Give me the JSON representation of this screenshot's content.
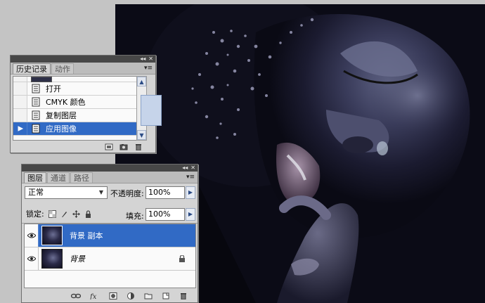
{
  "history_panel": {
    "tabs": [
      {
        "label": "历史记录",
        "active": true
      },
      {
        "label": "动作",
        "active": false
      }
    ],
    "items": [
      {
        "label": "",
        "partial": true,
        "selected": false
      },
      {
        "label": "打开",
        "selected": false
      },
      {
        "label": "CMYK 颜色",
        "selected": false
      },
      {
        "label": "复制图层",
        "selected": false
      },
      {
        "label": "应用图像",
        "selected": true
      }
    ],
    "footer_icons": [
      "new-document-from-state-icon",
      "camera-snapshot-icon",
      "trash-icon"
    ]
  },
  "layers_panel": {
    "tabs": [
      {
        "label": "图层",
        "active": true
      },
      {
        "label": "通道",
        "active": false
      },
      {
        "label": "路径",
        "active": false
      }
    ],
    "blend_mode": "正常",
    "opacity_label": "不透明度:",
    "opacity_value": "100%",
    "lock_label": "锁定:",
    "fill_label": "填充:",
    "fill_value": "100%",
    "layers": [
      {
        "name": "背景 副本",
        "selected": true,
        "visible": true,
        "locked": false,
        "italic": false
      },
      {
        "name": "背景",
        "selected": false,
        "visible": true,
        "locked": true,
        "italic": true
      }
    ],
    "footer_icons": [
      "link-icon",
      "fx-icon",
      "mask-icon",
      "adjustment-icon",
      "folder-icon",
      "new-layer-icon",
      "trash-icon"
    ]
  },
  "colors": {
    "selection": "#316ac5",
    "panel_bg": "#d4d4d4",
    "titlebar": "#474747",
    "workspace": "#c4c4c4"
  }
}
